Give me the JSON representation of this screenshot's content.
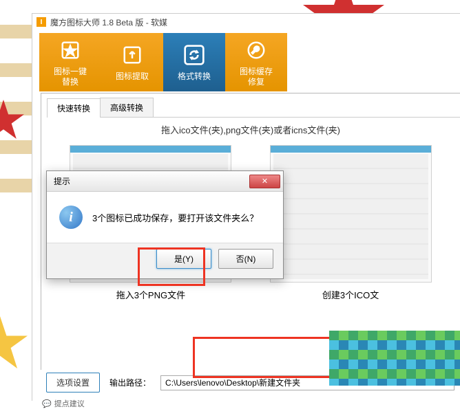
{
  "window": {
    "title": "魔方图标大师 1.8 Beta 版 - 软媒",
    "app_icon_letter": "I"
  },
  "toolbar": {
    "items": [
      {
        "label": "图标一键\n替换",
        "icon": "star-icon"
      },
      {
        "label": "图标提取",
        "icon": "upload-icon"
      },
      {
        "label": "格式转换",
        "icon": "refresh-icon"
      },
      {
        "label": "图标缓存\n修复",
        "icon": "wrench-icon"
      }
    ]
  },
  "tabs": {
    "items": [
      "快速转换",
      "高级转换"
    ],
    "active": 0
  },
  "instruction": "拖入ico文件(夹),png文件(夹)或者icns文件(夹)",
  "panels": {
    "left_caption": "拖入3个PNG文件",
    "right_caption": "创建3个ICO文"
  },
  "bottom": {
    "options_btn": "选项设置",
    "path_label": "输出路径：",
    "path_value": "C:\\Users\\lenovo\\Desktop\\新建文件夹"
  },
  "status": {
    "text": "提点建议"
  },
  "dialog": {
    "title": "提示",
    "message": "3个图标已成功保存，要打开该文件夹么？",
    "yes": "是(Y)",
    "no": "否(N)",
    "close": "✕"
  }
}
